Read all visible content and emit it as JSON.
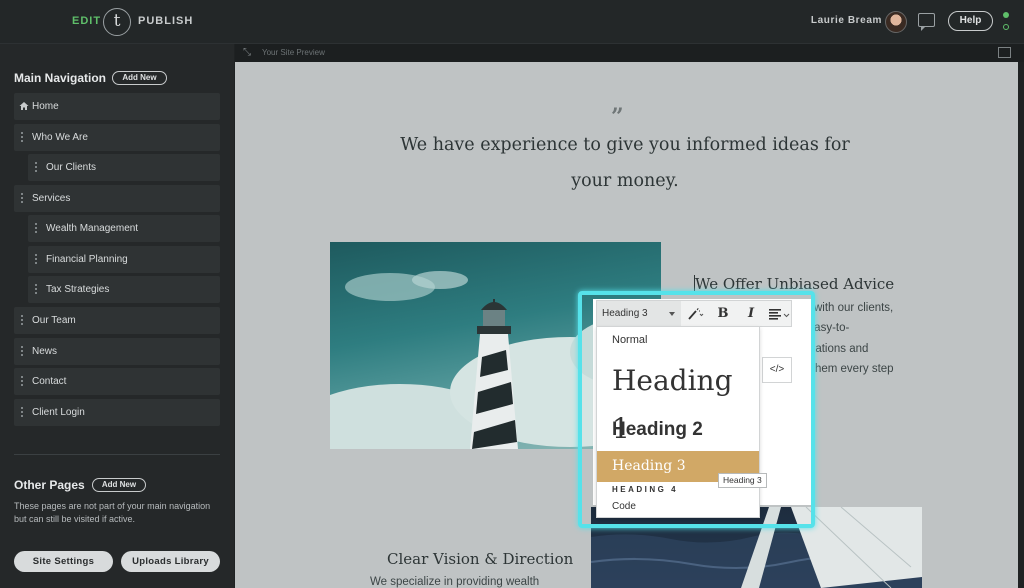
{
  "topbar": {
    "edit_label": "EDIT",
    "logo_letter": "t",
    "publish_label": "PUBLISH",
    "user_name": "Laurie Bream",
    "help_label": "Help",
    "status_colors": [
      "#5fbf6a",
      "#5fbf6a"
    ]
  },
  "sidebar": {
    "main_nav_title": "Main Navigation",
    "add_new_label": "Add New",
    "items": [
      {
        "label": "Home",
        "icon": "home-icon",
        "level": 0
      },
      {
        "label": "Who We Are",
        "icon": "grip-icon",
        "level": 0
      },
      {
        "label": "Our Clients",
        "icon": "grip-icon",
        "level": 1
      },
      {
        "label": "Services",
        "icon": "grip-icon",
        "level": 0
      },
      {
        "label": "Wealth Management",
        "icon": "grip-icon",
        "level": 1
      },
      {
        "label": "Financial Planning",
        "icon": "grip-icon",
        "level": 1
      },
      {
        "label": "Tax Strategies",
        "icon": "grip-icon",
        "level": 1
      },
      {
        "label": "Our Team",
        "icon": "grip-icon",
        "level": 0
      },
      {
        "label": "News",
        "icon": "grip-icon",
        "level": 0
      },
      {
        "label": "Contact",
        "icon": "grip-icon",
        "level": 0
      },
      {
        "label": "Client Login",
        "icon": "grip-icon",
        "level": 0
      }
    ],
    "other_pages_title": "Other Pages",
    "other_add_new_label": "Add New",
    "other_pages_note": "These pages are not part of your main navigation but can still be visited if active.",
    "site_settings_label": "Site Settings",
    "uploads_library_label": "Uploads Library"
  },
  "preview_bar": {
    "label": "Your Site Preview"
  },
  "preview": {
    "quote_mark": "”",
    "quote": "We have experience to give you informed ideas for your money.",
    "offer_heading": "We Offer Unbiased Advice",
    "offer_lines": [
      "with our clients,",
      "th easy-to-",
      "mmendations and",
      "ment them every step"
    ],
    "vision_heading": "Clear Vision & Direction",
    "vision_text": "We specialize in providing wealth"
  },
  "editor": {
    "format_selected": "Heading 3",
    "bold_label": "B",
    "italic_label": "I",
    "code_label": "</>",
    "dropdown_options": [
      "Normal",
      "Heading 1",
      "Heading 2",
      "Heading 3",
      "HEADING 4",
      "Code"
    ],
    "tooltip": "Heading 3",
    "accent_color": "#d1a866",
    "focus_color": "#56e2ea"
  }
}
